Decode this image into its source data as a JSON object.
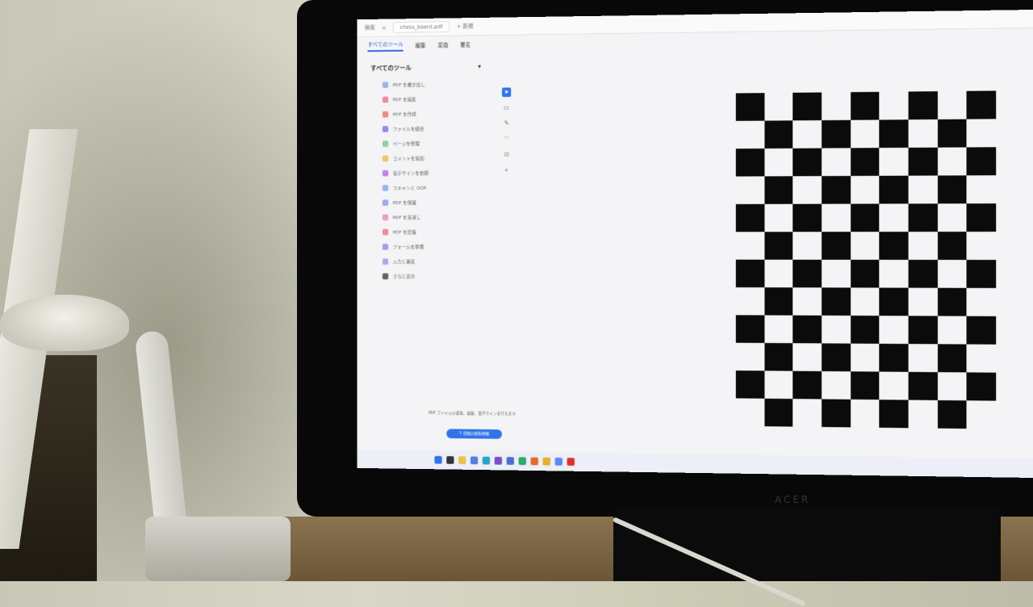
{
  "scene": {
    "description": "Photo of a monitor showing a PDF viewer with a checkerboard calibration pattern",
    "monitor_brand": "ACER"
  },
  "app": {
    "search_placeholder": "検索",
    "file_tab": "chess_board.pdf",
    "new_tab": "+ 新規"
  },
  "menu": {
    "items": [
      "すべてのツール",
      "編集",
      "変換",
      "署名"
    ]
  },
  "panel": {
    "title": "すべてのツール",
    "tools": [
      {
        "label": "PDF を書き出し",
        "color": "#9fb5e6"
      },
      {
        "label": "PDF を編集",
        "color": "#f18aa0"
      },
      {
        "label": "PDF を作成",
        "color": "#f08a8a"
      },
      {
        "label": "ファイルを結合",
        "color": "#9e86e6"
      },
      {
        "label": "ページを整理",
        "color": "#8fd0a0"
      },
      {
        "label": "コメントを追加",
        "color": "#f2c46a"
      },
      {
        "label": "電子サインを依頼",
        "color": "#c184e6"
      },
      {
        "label": "スキャンと OCR",
        "color": "#93b6ee"
      },
      {
        "label": "PDF を保護",
        "color": "#9fa8f0"
      },
      {
        "label": "PDF を墨消し",
        "color": "#e9a0c4"
      },
      {
        "label": "PDF を圧縮",
        "color": "#e7909a"
      },
      {
        "label": "フォームを準備",
        "color": "#b09af0"
      },
      {
        "label": "入力と署名",
        "color": "#b8a6ec"
      },
      {
        "label": "さらに表示",
        "color": "#666666"
      }
    ],
    "footer": "PDF ファイルの変換、編集、電子サインを行えます",
    "cta": "7 日間の無料体験"
  },
  "rail": {
    "icons": [
      "cursor-icon",
      "comment-icon",
      "pen-icon",
      "shape-icon",
      "zoom-area-icon",
      "search-zoom-icon"
    ]
  },
  "checkerboard": {
    "rows": 12,
    "cols": 9
  }
}
